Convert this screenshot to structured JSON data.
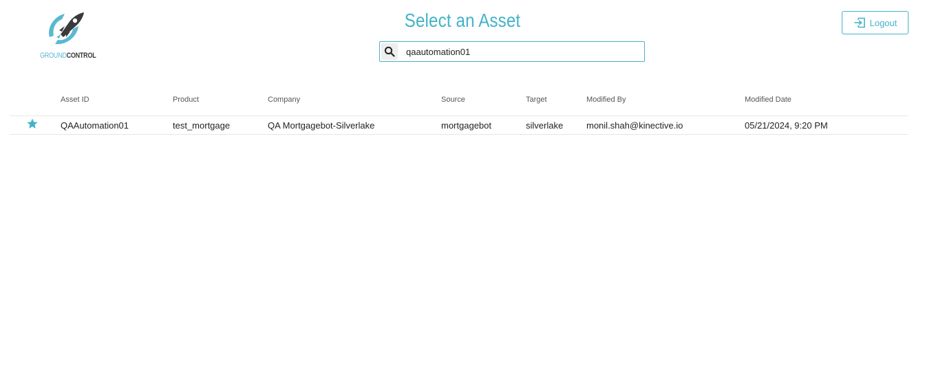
{
  "logo": {
    "text_ground": "GROUND",
    "text_control": "CONTROL",
    "icon": "rocket-icon",
    "colors": {
      "accent": "#5ab8d2",
      "dark": "#3a3a3a"
    }
  },
  "header": {
    "title": "Select an Asset",
    "logout_label": "Logout",
    "logout_icon": "logout-icon"
  },
  "search": {
    "icon": "search-icon",
    "value": "qaautomation01"
  },
  "table": {
    "columns": [
      "Asset ID",
      "Product",
      "Company",
      "Source",
      "Target",
      "Modified By",
      "Modified Date"
    ],
    "rows": [
      {
        "favorite_icon": "star-icon",
        "asset_id": "QAAutomation01",
        "product": "test_mortgage",
        "company": "QA Mortgagebot-Silverlake",
        "source": "mortgagebot",
        "target": "silverlake",
        "modified_by": "monil.shah@kinective.io",
        "modified_date": "05/21/2024, 9:20 PM"
      }
    ]
  },
  "colors": {
    "accent": "#43b3c8",
    "border": "#e6e6e6",
    "text": "#222222"
  }
}
